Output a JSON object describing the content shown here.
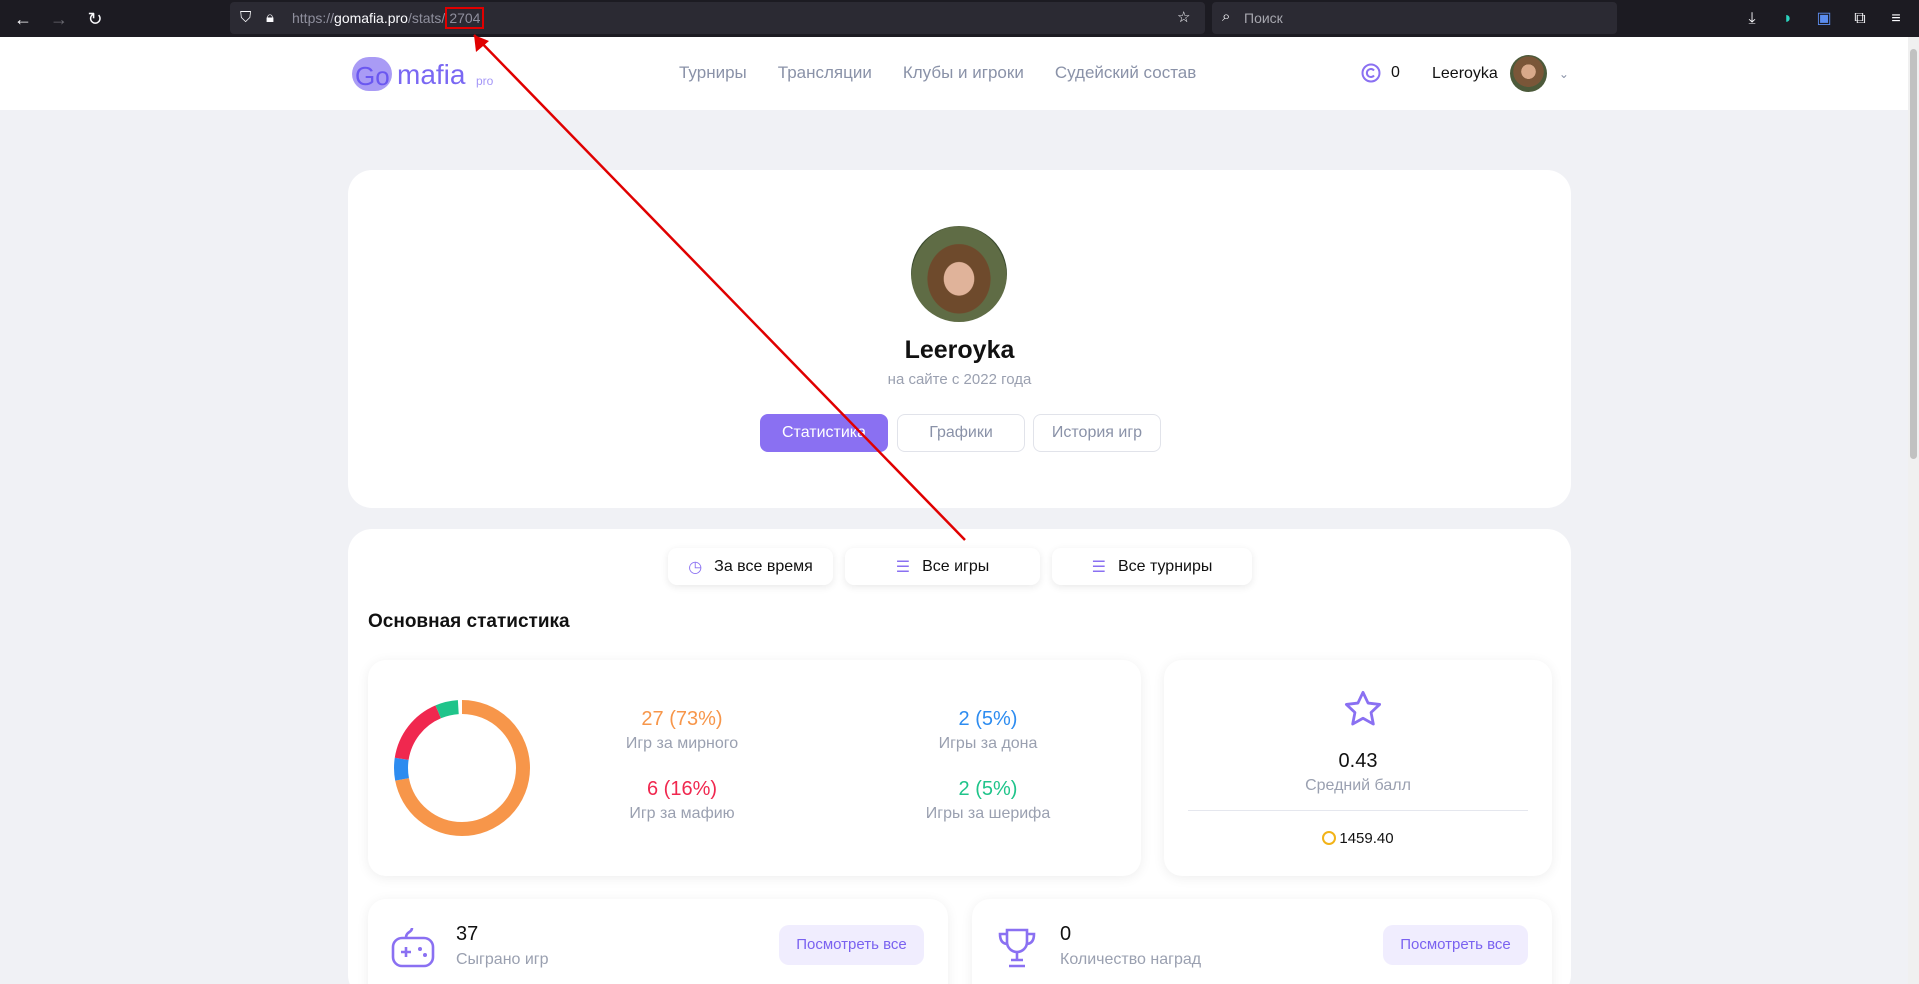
{
  "browser": {
    "url_scheme": "https://",
    "url_host": "gomafia.pro",
    "url_path": "/stats/",
    "url_id": "2704",
    "search_placeholder": "Поиск"
  },
  "header": {
    "logo_go": "Go",
    "logo_mafia": "mafia",
    "logo_pro": "pro",
    "nav": [
      "Турниры",
      "Трансляции",
      "Клубы и игроки",
      "Судейский состав"
    ],
    "coins": "0",
    "username": "Leeroyka"
  },
  "profile": {
    "name": "Leeroyka",
    "since": "на сайте с 2022 года",
    "tabs": [
      "Статистика",
      "Графики",
      "История игр"
    ]
  },
  "filters": [
    "За все время",
    "Все игры",
    "Все турниры"
  ],
  "main_stats": {
    "title": "Основная статистика",
    "items": [
      {
        "value": "27 (73%)",
        "label": "Игр за мирного",
        "color": "#f7964a"
      },
      {
        "value": "2 (5%)",
        "label": "Игры за дона",
        "color": "#2d8cf0"
      },
      {
        "value": "6 (16%)",
        "label": "Игр за мафию",
        "color": "#f0284f"
      },
      {
        "value": "2 (5%)",
        "label": "Игры за шерифа",
        "color": "#1fc48a"
      }
    ],
    "avg_score": "0.43",
    "avg_score_label": "Средний балл",
    "rating": "1459.40"
  },
  "bottom": {
    "games": "37",
    "games_label": "Сыграно игр",
    "awards": "0",
    "awards_label": "Количество наград",
    "see_all": "Посмотреть все"
  }
}
